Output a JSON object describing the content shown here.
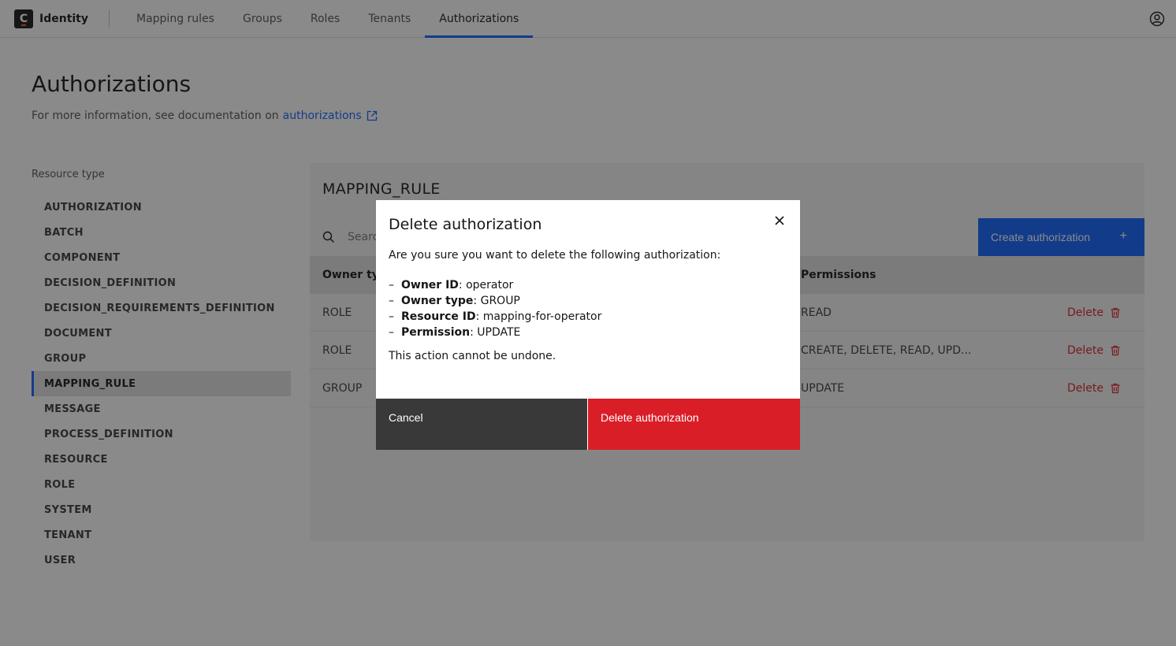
{
  "header": {
    "logo_letter": "C",
    "app_name": "Identity",
    "nav": [
      {
        "label": "Mapping rules"
      },
      {
        "label": "Groups"
      },
      {
        "label": "Roles"
      },
      {
        "label": "Tenants"
      },
      {
        "label": "Authorizations",
        "active": true
      }
    ],
    "user_icon": "user-avatar-icon"
  },
  "page": {
    "title": "Authorizations",
    "subtitle_prefix": "For more information, see documentation on",
    "doc_link": "authorizations"
  },
  "resource_types": {
    "label": "Resource type",
    "items": [
      "AUTHORIZATION",
      "BATCH",
      "COMPONENT",
      "DECISION_DEFINITION",
      "DECISION_REQUIREMENTS_DEFINITION",
      "DOCUMENT",
      "GROUP",
      "MAPPING_RULE",
      "MESSAGE",
      "PROCESS_DEFINITION",
      "RESOURCE",
      "ROLE",
      "SYSTEM",
      "TENANT",
      "USER"
    ],
    "selected": "MAPPING_RULE"
  },
  "panel": {
    "title": "MAPPING_RULE",
    "search_placeholder": "Search",
    "create_label": "Create authorization",
    "columns": {
      "owner_type": "Owner type",
      "permissions": "Permissions"
    },
    "rows": [
      {
        "owner_type": "ROLE",
        "permissions": "READ",
        "delete_label": "Delete"
      },
      {
        "owner_type": "ROLE",
        "permissions": "CREATE, DELETE, READ, UPD...",
        "delete_label": "Delete"
      },
      {
        "owner_type": "GROUP",
        "permissions": "UPDATE",
        "delete_label": "Delete"
      }
    ]
  },
  "modal": {
    "title": "Delete authorization",
    "intro": "Are you sure you want to delete the following authorization:",
    "fields": [
      {
        "label": "Owner ID",
        "value": "operator"
      },
      {
        "label": "Owner type",
        "value": "GROUP"
      },
      {
        "label": "Resource ID",
        "value": "mapping-for-operator"
      },
      {
        "label": "Permission",
        "value": "UPDATE"
      }
    ],
    "warning": "This action cannot be undone.",
    "cancel_label": "Cancel",
    "confirm_label": "Delete authorization"
  },
  "colors": {
    "primary": "#0f62fe",
    "danger": "#da1e28",
    "secondary": "#393939"
  }
}
